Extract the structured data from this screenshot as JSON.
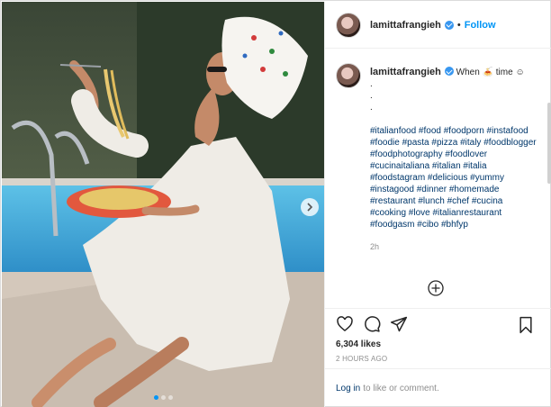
{
  "header": {
    "username": "lamittafrangieh",
    "separator": "•",
    "follow_label": "Follow"
  },
  "caption": {
    "username": "lamittafrangieh",
    "text": "When 🍝 time ☺",
    "dots": [
      ".",
      ".",
      "."
    ],
    "hashtags": "#italianfood #food #foodporn #instafood #foodie #pasta #pizza #italy #foodblogger #foodphotography #foodlover #cucinaitaliana #italian #italia #foodstagram #delicious #yummy #instagood #dinner #homemade #restaurant #lunch #chef #cucina #cooking #love #italianrestaurant #foodgasm #cibo #bhfyp",
    "time_ago": "2h"
  },
  "actions": {
    "likes": "6,304 likes",
    "posted": "2 HOURS AGO"
  },
  "login": {
    "link": "Log in",
    "rest": "to like or comment."
  },
  "carousel": {
    "slides": 3,
    "active": 1
  },
  "colors": {
    "accent": "#0095f6",
    "hashtag": "#00376b",
    "muted": "#8e8e8e",
    "verified": "#3897f0"
  },
  "icons": [
    "heart-icon",
    "comment-icon",
    "share-icon",
    "save-icon",
    "add-circle-icon",
    "chevron-right-icon",
    "verified-badge-icon"
  ]
}
